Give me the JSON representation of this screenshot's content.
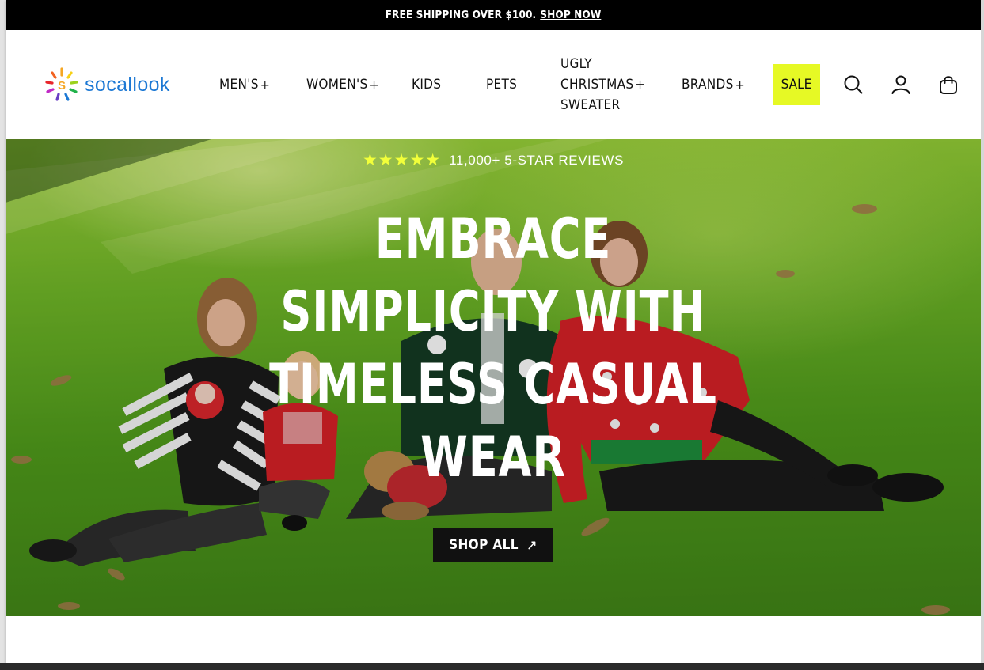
{
  "announcement": {
    "text": "FREE SHIPPING OVER $100.",
    "link_label": "SHOP NOW"
  },
  "header": {
    "logo_text": "socallook",
    "nav": [
      {
        "label": "MEN'S",
        "plus": "+"
      },
      {
        "label": "WOMEN'S",
        "plus": "+"
      },
      {
        "label": "KIDS",
        "plus": ""
      },
      {
        "label": "PETS",
        "plus": ""
      },
      {
        "label_line1": "UGLY",
        "label_line2": "CHRISTMAS",
        "label_line3": "SWEATER",
        "plus": "+"
      },
      {
        "label": "BRANDS",
        "plus": "+"
      }
    ],
    "sale_label": "SALE",
    "icons": [
      "search-icon",
      "account-icon",
      "cart-icon"
    ],
    "sale_color": "#e6f925"
  },
  "hero": {
    "stars": "★★★★★",
    "reviews_text": "11,000+ 5-STAR REVIEWS",
    "headline_line1": "EMBRACE",
    "headline_line2": "SIMPLICITY WITH",
    "headline_line3": "TIMELESS CASUAL",
    "headline_line4": "WEAR",
    "cta_label": "SHOP ALL",
    "cta_arrow": "↗"
  },
  "colors": {
    "brand_blue": "#1c78d4",
    "star_yellow": "#f2ff3a",
    "cta_bg": "#111111"
  }
}
